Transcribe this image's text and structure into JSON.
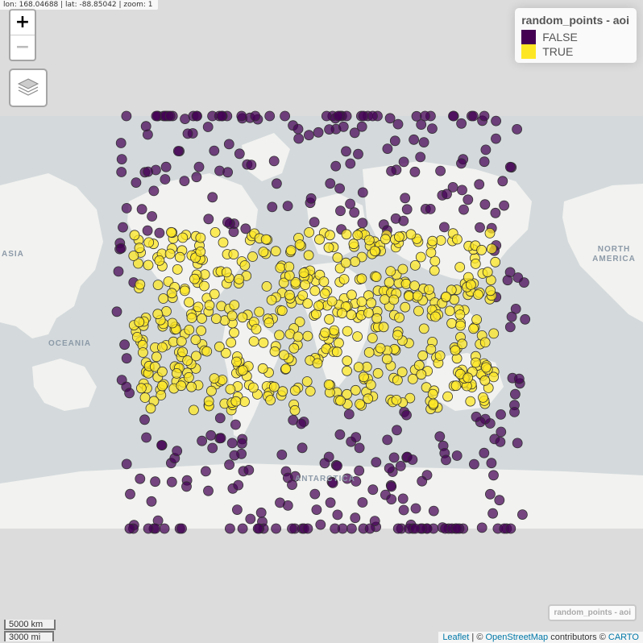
{
  "coord_readout": "lon: 168.04688 | lat: -88.85042 | zoom: 1",
  "zoom": {
    "in_label": "+",
    "out_label": "−"
  },
  "legend": {
    "title": "random_points - aoi",
    "items": [
      {
        "label": "FALSE",
        "color": "#440154"
      },
      {
        "label": "TRUE",
        "color": "#FDE725"
      }
    ]
  },
  "layer_toggle_label": "random_points - aoi",
  "scale": {
    "top": "5000 km",
    "bottom": "3000 mi"
  },
  "attribution": {
    "leaflet": "Leaflet",
    "sep": " | © ",
    "osm": "OpenStreetMap",
    "mid": " contributors © ",
    "carto": "CARTO"
  },
  "map_labels": [
    "ASIA",
    "NORTH AMERICA",
    "OCEANIA",
    "ANTARCTICA"
  ],
  "icons": {
    "layers": "layers-icon"
  }
}
